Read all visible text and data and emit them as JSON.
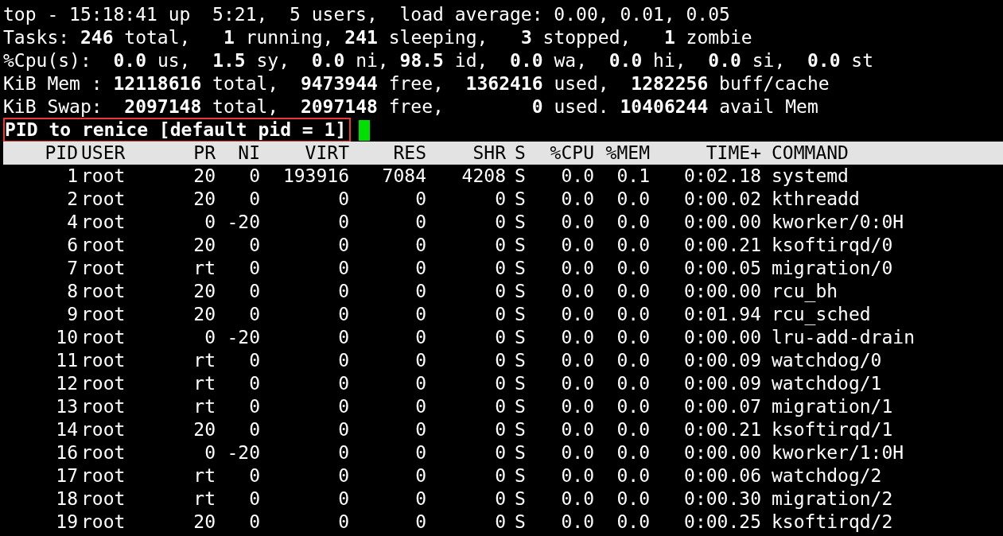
{
  "summary_lines": [
    "top - 15:18:41 up  5:21,  5 users,  load average: 0.00, 0.01, 0.05",
    "Tasks: **246** total,   **1** running, **241** sleeping,   **3** stopped,   **1** zombie",
    "%Cpu(s):  **0.0** us,  **1.5** sy,  **0.0** ni, **98.5** id,  **0.0** wa,  **0.0** hi,  **0.0** si,  **0.0** st",
    "KiB Mem : **12118616** total,  **9473944** free,  **1362416** used,  **1282256** buff/cache",
    "KiB Swap:  **2097148** total,  **2097148** free,        **0** used. **10406244** avail Mem"
  ],
  "prompt": {
    "text": "PID to renice [default pid = 1]",
    "highlighted": true
  },
  "table": {
    "columns": [
      "PID",
      "USER",
      "PR",
      "NI",
      "VIRT",
      "RES",
      "SHR",
      "S",
      "%CPU",
      "%MEM",
      "TIME+",
      "COMMAND"
    ],
    "rows": [
      [
        "1",
        "root",
        "20",
        "0",
        "193916",
        "7084",
        "4208",
        "S",
        "0.0",
        "0.1",
        "0:02.18",
        "systemd"
      ],
      [
        "2",
        "root",
        "20",
        "0",
        "0",
        "0",
        "0",
        "S",
        "0.0",
        "0.0",
        "0:00.02",
        "kthreadd"
      ],
      [
        "4",
        "root",
        "0",
        "-20",
        "0",
        "0",
        "0",
        "S",
        "0.0",
        "0.0",
        "0:00.00",
        "kworker/0:0H"
      ],
      [
        "6",
        "root",
        "20",
        "0",
        "0",
        "0",
        "0",
        "S",
        "0.0",
        "0.0",
        "0:00.21",
        "ksoftirqd/0"
      ],
      [
        "7",
        "root",
        "rt",
        "0",
        "0",
        "0",
        "0",
        "S",
        "0.0",
        "0.0",
        "0:00.05",
        "migration/0"
      ],
      [
        "8",
        "root",
        "20",
        "0",
        "0",
        "0",
        "0",
        "S",
        "0.0",
        "0.0",
        "0:00.00",
        "rcu_bh"
      ],
      [
        "9",
        "root",
        "20",
        "0",
        "0",
        "0",
        "0",
        "S",
        "0.0",
        "0.0",
        "0:01.94",
        "rcu_sched"
      ],
      [
        "10",
        "root",
        "0",
        "-20",
        "0",
        "0",
        "0",
        "S",
        "0.0",
        "0.0",
        "0:00.00",
        "lru-add-drain"
      ],
      [
        "11",
        "root",
        "rt",
        "0",
        "0",
        "0",
        "0",
        "S",
        "0.0",
        "0.0",
        "0:00.09",
        "watchdog/0"
      ],
      [
        "12",
        "root",
        "rt",
        "0",
        "0",
        "0",
        "0",
        "S",
        "0.0",
        "0.0",
        "0:00.09",
        "watchdog/1"
      ],
      [
        "13",
        "root",
        "rt",
        "0",
        "0",
        "0",
        "0",
        "S",
        "0.0",
        "0.0",
        "0:00.07",
        "migration/1"
      ],
      [
        "14",
        "root",
        "20",
        "0",
        "0",
        "0",
        "0",
        "S",
        "0.0",
        "0.0",
        "0:00.21",
        "ksoftirqd/1"
      ],
      [
        "16",
        "root",
        "0",
        "-20",
        "0",
        "0",
        "0",
        "S",
        "0.0",
        "0.0",
        "0:00.00",
        "kworker/1:0H"
      ],
      [
        "17",
        "root",
        "rt",
        "0",
        "0",
        "0",
        "0",
        "S",
        "0.0",
        "0.0",
        "0:00.06",
        "watchdog/2"
      ],
      [
        "18",
        "root",
        "rt",
        "0",
        "0",
        "0",
        "0",
        "S",
        "0.0",
        "0.0",
        "0:00.30",
        "migration/2"
      ],
      [
        "19",
        "root",
        "20",
        "0",
        "0",
        "0",
        "0",
        "S",
        "0.0",
        "0.0",
        "0:00.25",
        "ksoftirqd/2"
      ]
    ]
  }
}
